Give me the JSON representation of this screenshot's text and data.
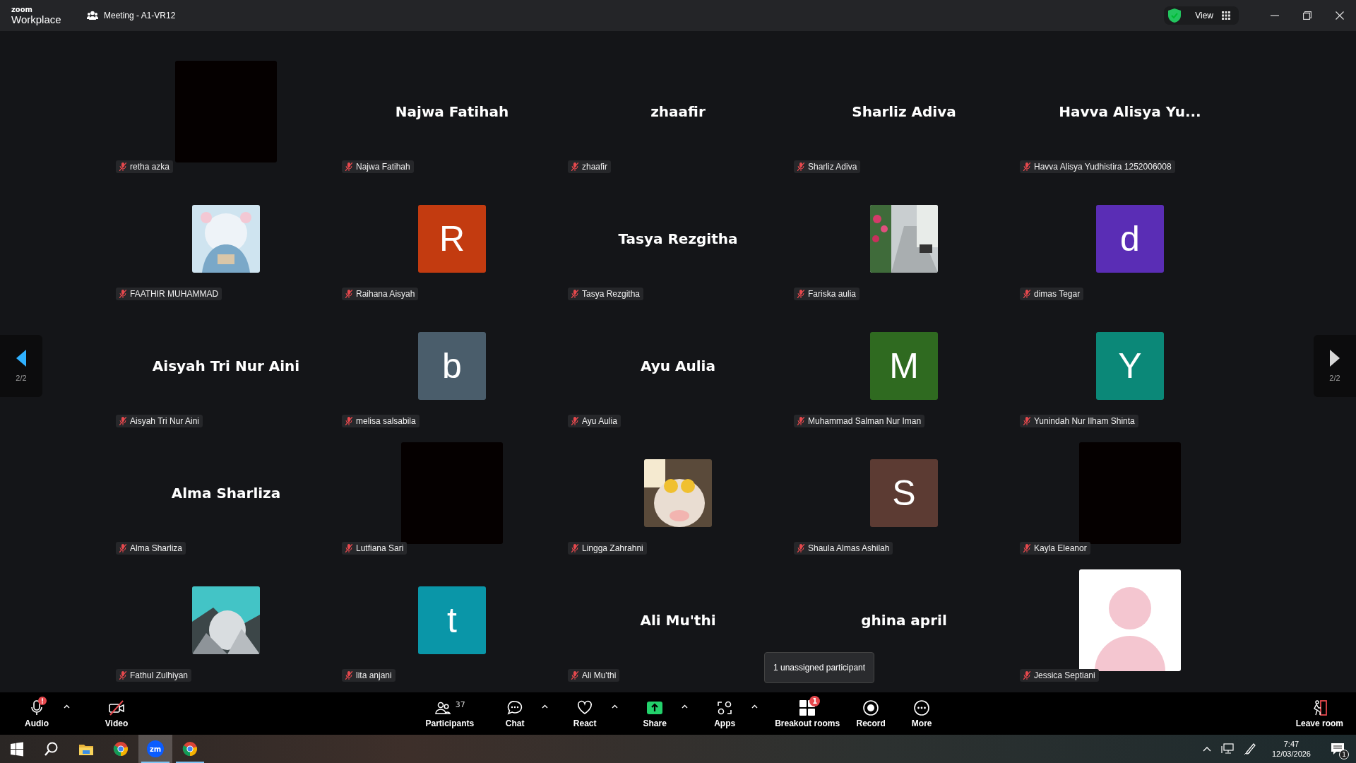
{
  "title_bar": {
    "logo_small": "zoom",
    "logo": "Workplace",
    "meeting_title": "Meeting - A1-VR12",
    "view_label": "View"
  },
  "pager": [
    {
      "kind": "previous",
      "label": "2/2",
      "active": true
    },
    {
      "kind": "next",
      "label": "2/2",
      "active": false
    }
  ],
  "tiles": [
    {
      "kind": "blank",
      "name": "retha azka",
      "muted": true
    },
    {
      "kind": "name",
      "display": "Najwa Fatihah",
      "name": "Najwa Fatihah",
      "muted": true
    },
    {
      "kind": "name",
      "display": "zhaafir",
      "name": "zhaafir",
      "muted": true
    },
    {
      "kind": "name",
      "display": "Sharliz Adiva",
      "name": "Sharliz Adiva",
      "muted": true
    },
    {
      "kind": "name",
      "display": "Havva Alisya Yu...",
      "name": "Havva Alisya Yudhistira 1252006008",
      "muted": true
    },
    {
      "kind": "picture",
      "name": "FAATHIR MUHAMMAD",
      "muted": true
    },
    {
      "kind": "letter",
      "letter": "R",
      "color": "#c33b10",
      "name": "Raihana Aisyah",
      "muted": true
    },
    {
      "kind": "name",
      "display": "Tasya Rezgitha",
      "name": "Tasya Rezgitha",
      "muted": true
    },
    {
      "kind": "picture",
      "name": "Fariska aulia",
      "muted": true
    },
    {
      "kind": "letter",
      "letter": "d",
      "color": "#5a2db5",
      "name": "dimas Tegar",
      "muted": true
    },
    {
      "kind": "name",
      "display": "Aisyah Tri Nur Aini",
      "name": "Aisyah Tri Nur Aini",
      "muted": true
    },
    {
      "kind": "letter",
      "letter": "b",
      "color": "#4a5d6b",
      "name": "melisa salsabila",
      "muted": true
    },
    {
      "kind": "name",
      "display": "Ayu Aulia",
      "name": "Ayu Aulia",
      "muted": true
    },
    {
      "kind": "letter",
      "letter": "M",
      "color": "#2f6a20",
      "name": "Muhammad Salman Nur Iman",
      "muted": true
    },
    {
      "kind": "letter",
      "letter": "Y",
      "color": "#0b8878",
      "name": "Yunindah Nur Ilham Shinta",
      "muted": true
    },
    {
      "kind": "name",
      "display": "Alma Sharliza",
      "name": "Alma Sharliza",
      "muted": true
    },
    {
      "kind": "blank",
      "name": "Lutfiana Sari",
      "muted": true
    },
    {
      "kind": "picture",
      "name": "Lingga Zahrahni",
      "muted": true
    },
    {
      "kind": "letter",
      "letter": "S",
      "color": "#5c3b33",
      "name": "Shaula Almas Ashilah",
      "muted": true
    },
    {
      "kind": "blank",
      "name": "Kayla Eleanor",
      "muted": true
    },
    {
      "kind": "picture",
      "name": "Fathul Zulhiyan",
      "muted": true
    },
    {
      "kind": "letter",
      "letter": "t",
      "color": "#0a96a8",
      "name": "lita anjani",
      "muted": true
    },
    {
      "kind": "name",
      "display": "Ali Mu'thi",
      "name": "Ali Mu'thi",
      "muted": true
    },
    {
      "kind": "name",
      "display": "ghina april"
    },
    {
      "kind": "default",
      "name": "Jessica Septiani",
      "muted": true
    }
  ],
  "tooltip": "1 unassigned participant",
  "toolbar": [
    {
      "kind": "audio",
      "label": "Audio",
      "caret": true,
      "alert": true
    },
    {
      "kind": "video",
      "label": "Video",
      "caret": false,
      "alert": false
    },
    {
      "kind": "participants",
      "label": "Participants",
      "count": "37",
      "caret": false,
      "alert": false
    },
    {
      "kind": "chat",
      "label": "Chat",
      "caret": true,
      "alert": false
    },
    {
      "kind": "react",
      "label": "React",
      "caret": true,
      "alert": false
    },
    {
      "kind": "share",
      "label": "Share",
      "caret": true,
      "alert": false
    },
    {
      "kind": "apps",
      "label": "Apps",
      "caret": true,
      "alert": false
    },
    {
      "kind": "breakout",
      "label": "Breakout rooms",
      "badge": "1",
      "caret": false,
      "alert": false
    },
    {
      "kind": "record",
      "label": "Record",
      "caret": false,
      "alert": false
    },
    {
      "kind": "more",
      "label": "More",
      "caret": false,
      "alert": false
    },
    {
      "kind": "leave",
      "label": "Leave room",
      "caret": false,
      "alert": false
    }
  ],
  "taskbar": {
    "apps": [
      {
        "kind": "start",
        "selected": false,
        "running": false
      },
      {
        "kind": "search",
        "selected": false,
        "running": false
      },
      {
        "kind": "explorer",
        "selected": false,
        "running": false
      },
      {
        "kind": "chrome",
        "selected": false,
        "running": false
      },
      {
        "kind": "zoom",
        "text": "zm",
        "selected": true,
        "running": true
      },
      {
        "kind": "chrome",
        "selected": false,
        "running": true
      }
    ],
    "time": "7:47",
    "date": "12/03/2026",
    "notifications": "1"
  }
}
